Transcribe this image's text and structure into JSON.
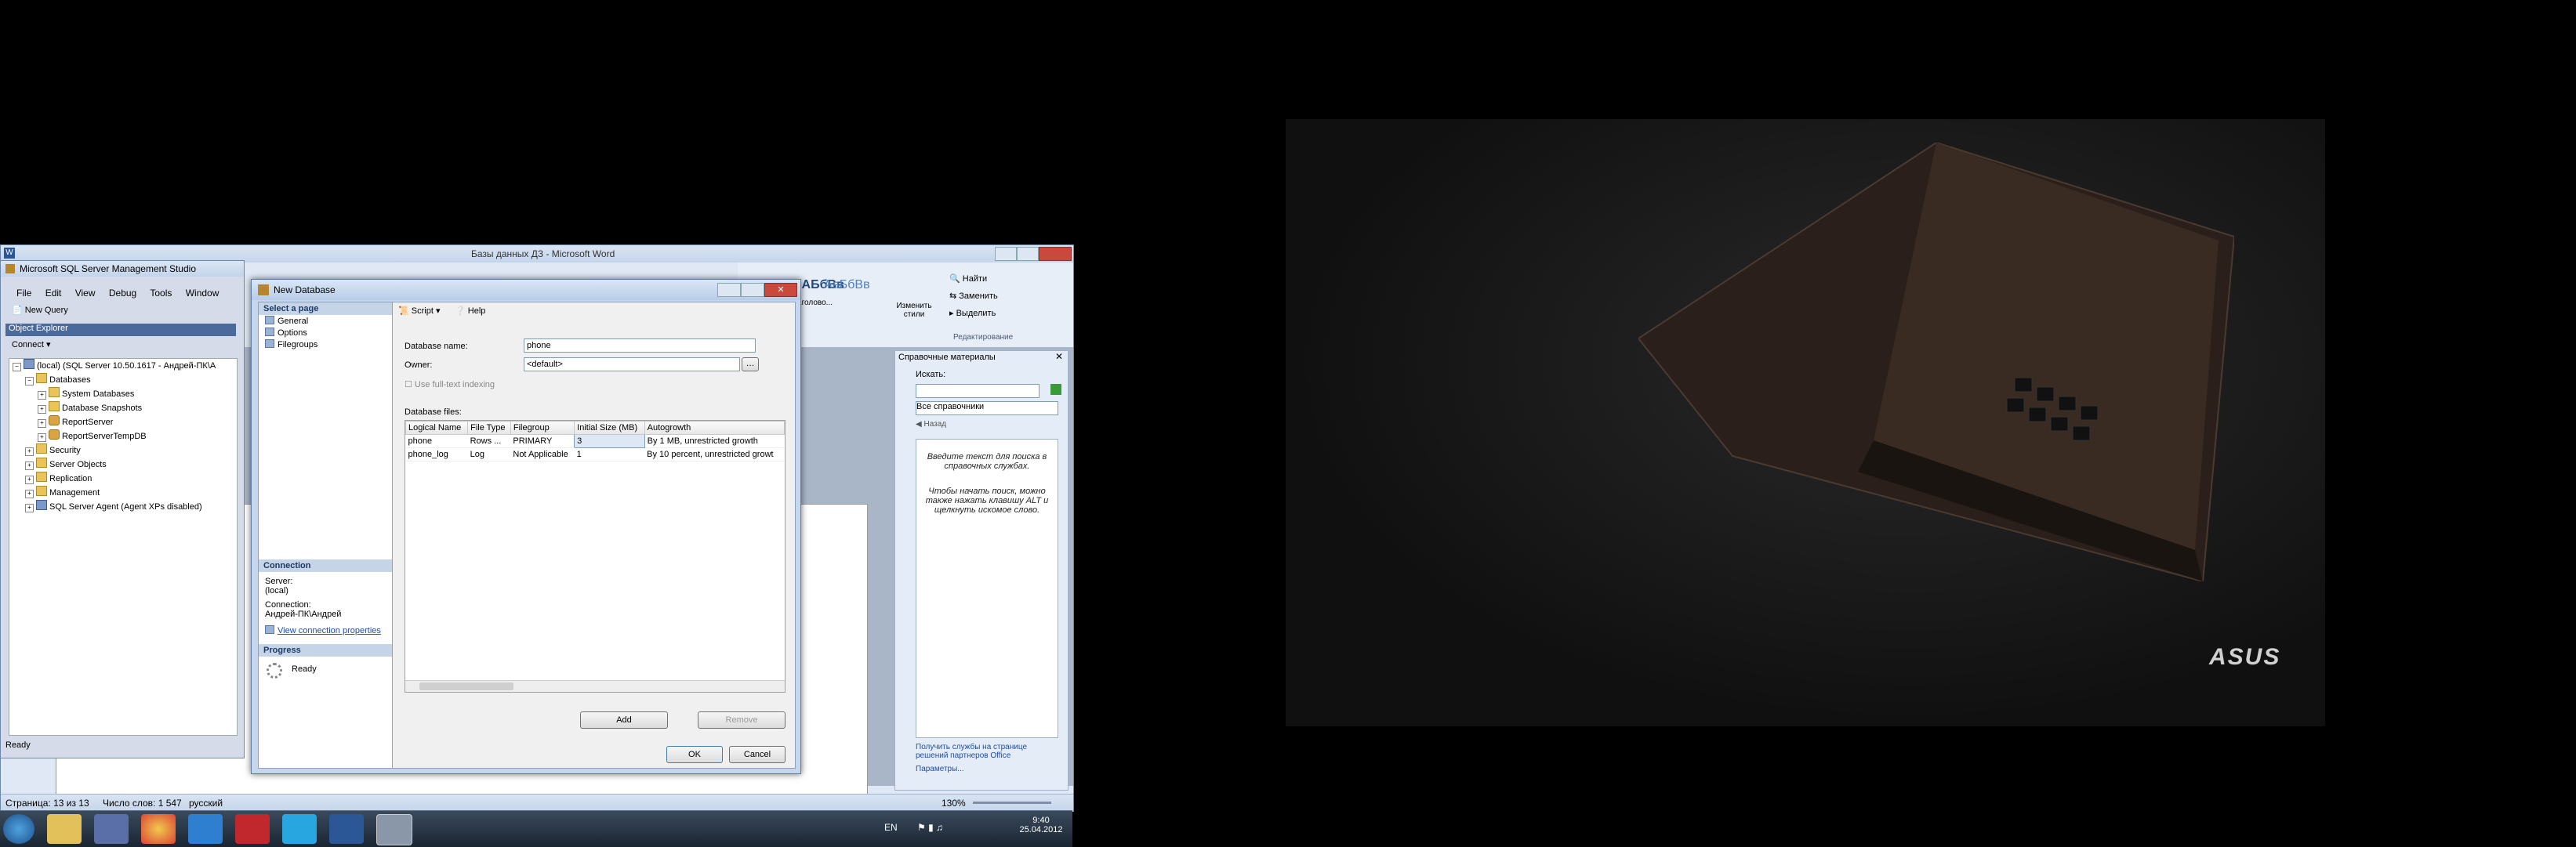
{
  "word": {
    "title": "Базы данных ДЗ - Microsoft Word",
    "ribbon": {
      "style_sample_1": "ААБбВв",
      "style_sample_2": "АаБбВв",
      "style_label": "Заголово...",
      "change_styles": "Изменить стили",
      "find": "Найти",
      "replace": "Заменить",
      "select": "Выделить",
      "editing_group": "Редактирование"
    },
    "status": {
      "page": "Страница: 13 из 13",
      "words": "Число слов: 1 547",
      "language": "русский",
      "zoom": "130%"
    }
  },
  "ssms": {
    "title": "Microsoft SQL Server Management Studio",
    "menu": [
      "File",
      "Edit",
      "View",
      "Debug",
      "Tools",
      "Window"
    ],
    "toolbar_new_query": "New Query",
    "object_explorer": {
      "title": "Object Explorer",
      "connect": "Connect",
      "tree": [
        {
          "label": "(local) (SQL Server 10.50.1617 - Андрей-ПК\\А",
          "level": 0,
          "icon": "server-icon"
        },
        {
          "label": "Databases",
          "level": 1,
          "icon": "folder-icon"
        },
        {
          "label": "System Databases",
          "level": 2,
          "icon": "folder-icon"
        },
        {
          "label": "Database Snapshots",
          "level": 2,
          "icon": "folder-icon"
        },
        {
          "label": "ReportServer",
          "level": 2,
          "icon": "database-icon"
        },
        {
          "label": "ReportServerTempDB",
          "level": 2,
          "icon": "database-icon"
        },
        {
          "label": "Security",
          "level": 1,
          "icon": "folder-icon"
        },
        {
          "label": "Server Objects",
          "level": 1,
          "icon": "folder-icon"
        },
        {
          "label": "Replication",
          "level": 1,
          "icon": "folder-icon"
        },
        {
          "label": "Management",
          "level": 1,
          "icon": "folder-icon"
        },
        {
          "label": "SQL Server Agent (Agent XPs disabled)",
          "level": 1,
          "icon": "agent-icon"
        }
      ]
    },
    "status": "Ready"
  },
  "dialog": {
    "title": "New Database",
    "select_page": "Select a page",
    "pages": [
      "General",
      "Options",
      "Filegroups"
    ],
    "script": "Script",
    "help": "Help",
    "connection_header": "Connection",
    "server_label": "Server:",
    "server_value": "(local)",
    "connection_label": "Connection:",
    "connection_value": "Андрей-ПК\\Андрей",
    "view_connection": "View connection properties",
    "progress_header": "Progress",
    "progress_status": "Ready",
    "db_name_label": "Database name:",
    "db_name_value": "phone",
    "owner_label": "Owner:",
    "owner_value": "<default>",
    "fulltext_label": "Use full-text indexing",
    "files_label": "Database files:",
    "columns": [
      "Logical Name",
      "File Type",
      "Filegroup",
      "Initial Size (MB)",
      "Autogrowth"
    ],
    "rows": [
      [
        "phone",
        "Rows ...",
        "PRIMARY",
        "3",
        "By 1 MB, unrestricted growth"
      ],
      [
        "phone_log",
        "Log",
        "Not Applicable",
        "1",
        "By 10 percent, unrestricted growt"
      ]
    ],
    "add": "Add",
    "remove": "Remove",
    "ok": "OK",
    "cancel": "Cancel"
  },
  "reference": {
    "title": "Справочные материалы",
    "search_label": "Искать:",
    "all_refs": "Все справочники",
    "back": "Назад",
    "message": "Введите текст для поиска в справочных службах.",
    "message2": "Чтобы начать поиск, можно также нажать клавишу ALT и щелкнуть искомое слово.",
    "link1": "Получить службы на странице решений партнеров Office",
    "link2": "Параметры..."
  },
  "wallpaper": {
    "logo": "ASUS"
  },
  "taskbar": {
    "lang": "EN",
    "time": "9:40",
    "date": "25.04.2012"
  }
}
